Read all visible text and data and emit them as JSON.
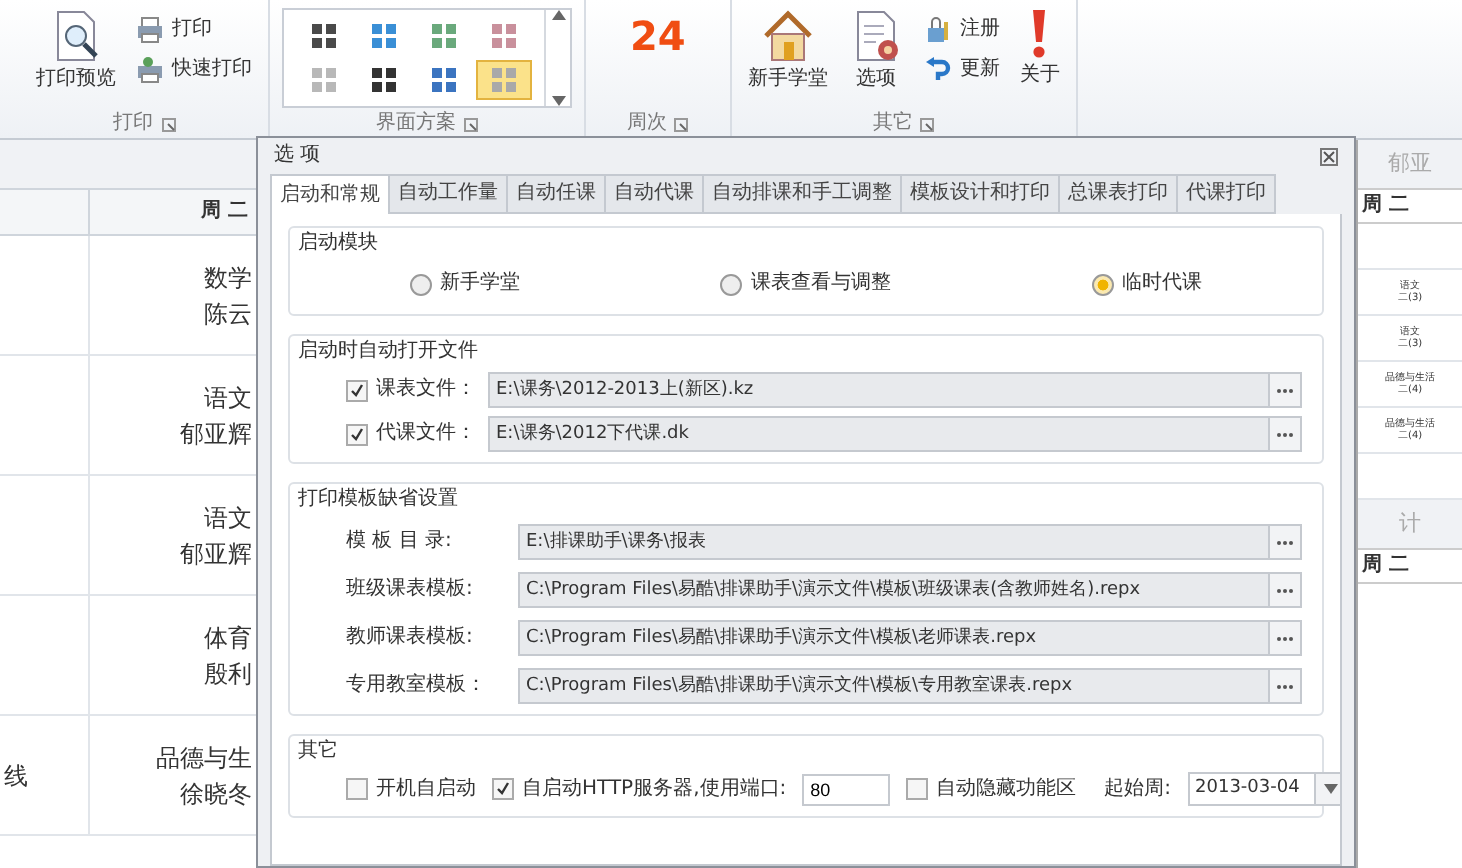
{
  "ribbon": {
    "print": {
      "label": "打印",
      "buttons": [
        {
          "kind": "preview",
          "label": "打印预览"
        },
        {
          "kind": "print",
          "label": "打印"
        },
        {
          "kind": "quick_print",
          "label": "快速打印"
        }
      ]
    },
    "theme": {
      "label": "界面方案",
      "swatches": [
        {
          "color": "#4a4a4a",
          "selected": false
        },
        {
          "color": "#3a8fd6",
          "selected": false
        },
        {
          "color": "#6aa97c",
          "selected": false
        },
        {
          "color": "#c9909c",
          "selected": false
        },
        {
          "color": "#b8b8b8",
          "selected": false
        },
        {
          "color": "#333333",
          "selected": false
        },
        {
          "color": "#3b74c0",
          "selected": false
        },
        {
          "color": "#a9a9a9",
          "selected": true
        }
      ]
    },
    "week": {
      "label": "周次",
      "value": "24"
    },
    "other": {
      "label": "其它",
      "buttons": [
        {
          "kind": "home",
          "label": "新手学堂"
        },
        {
          "kind": "options",
          "label": "选项"
        },
        {
          "kind": "register",
          "label": "注册"
        },
        {
          "kind": "update",
          "label": "更新"
        },
        {
          "kind": "about",
          "label": "关于"
        }
      ]
    }
  },
  "schedule": {
    "header": "周 二",
    "rows": [
      {
        "lines": [
          "数学",
          "陈云"
        ]
      },
      {
        "lines": [
          "语文",
          "郁亚辉"
        ]
      },
      {
        "lines": [
          "语文",
          "郁亚辉"
        ]
      },
      {
        "lines": [
          "体育",
          "殷利"
        ]
      },
      {
        "column_1": "线",
        "lines": [
          "品德与生",
          "徐晓冬"
        ]
      }
    ]
  },
  "dialog": {
    "title": "选 项",
    "tabs": [
      {
        "label": "启动和常规",
        "selected": true
      },
      {
        "label": "自动工作量",
        "selected": false
      },
      {
        "label": "自动任课",
        "selected": false
      },
      {
        "label": "自动代课",
        "selected": false
      },
      {
        "label": "自动排课和手工调整",
        "selected": false
      },
      {
        "label": "模板设计和打印",
        "selected": false
      },
      {
        "label": "总课表打印",
        "selected": false
      },
      {
        "label": "代课打印",
        "selected": false
      }
    ],
    "startup_module": {
      "title": "启动模块",
      "options": [
        {
          "label": "新手学堂",
          "selected": false
        },
        {
          "label": "课表查看与调整",
          "selected": false
        },
        {
          "label": "临时代课",
          "selected": true
        }
      ]
    },
    "auto_open": {
      "title": "启动时自动打开文件",
      "files": [
        {
          "label": "课表文件：",
          "checked": true,
          "value": "E:\\课务\\2012-2013上(新区).kz"
        },
        {
          "label": "代课文件：",
          "checked": true,
          "value": "E:\\课务\\2012下代课.dk"
        }
      ]
    },
    "print_templates": {
      "title": "打印模板缺省设置",
      "fields": [
        {
          "label": "模 板 目 录:",
          "value": "E:\\排课助手\\课务\\报表"
        },
        {
          "label": "班级课表模板:",
          "value": "C:\\Program Files\\易酷\\排课助手\\演示文件\\模板\\班级课表(含教师姓名).repx"
        },
        {
          "label": "教师课表模板:",
          "value": "C:\\Program Files\\易酷\\排课助手\\演示文件\\模板\\老师课表.repx"
        },
        {
          "label": "专用教室模板：",
          "value": "C:\\Program Files\\易酷\\排课助手\\演示文件\\模板\\专用教室课表.repx"
        }
      ]
    },
    "other": {
      "title": "其它",
      "autostart": {
        "label": "开机自启动",
        "checked": false
      },
      "http": {
        "label": "自启动HTTP服务器,使用端口:",
        "checked": true,
        "port": "80"
      },
      "hide_ribbon": {
        "label": "自动隐藏功能区",
        "checked": false
      },
      "start_week": {
        "label": "起始周:",
        "value": "2013-03-04"
      }
    }
  },
  "right_panel": {
    "title": "郁亚",
    "header": "周 二",
    "rows": [
      {
        "lines": []
      },
      {
        "lines": [
          "语文",
          "二(3)"
        ]
      },
      {
        "lines": [
          "语文",
          "二(3)"
        ]
      },
      {
        "lines": [
          "品德与生活",
          "二(4)"
        ]
      },
      {
        "lines": [
          "品德与生活",
          "二(4)"
        ]
      },
      {
        "lines": []
      }
    ],
    "title_2": "计",
    "header_2": "周 二"
  }
}
